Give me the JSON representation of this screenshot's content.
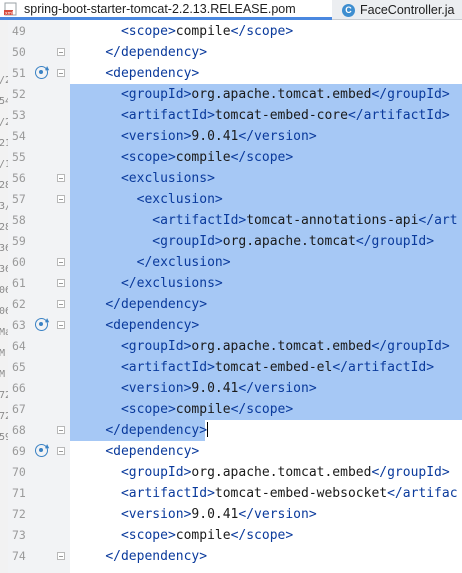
{
  "tabs": [
    {
      "label": "spring-boot-starter-tomcat-2.2.13.RELEASE.pom",
      "icon": "xml-file-icon",
      "active": true
    },
    {
      "label": "FaceController.ja",
      "icon": "java-class-icon",
      "active": false
    }
  ],
  "left_fragments": [
    "/2",
    "54",
    "/2",
    "21",
    "/1",
    "28",
    "3/",
    "28",
    "36",
    "36",
    "06",
    "06",
    "Ma",
    "M",
    "M",
    "72",
    "72",
    "59"
  ],
  "lines": [
    {
      "n": 49,
      "indent": 3,
      "parts": [
        [
          "tag",
          "<"
        ],
        [
          "tag",
          "scope"
        ],
        [
          "tag",
          ">"
        ],
        [
          "txt",
          "compile"
        ],
        [
          "tag",
          "</"
        ],
        [
          "tag",
          "scope"
        ],
        [
          "tag",
          ">"
        ]
      ]
    },
    {
      "n": 50,
      "indent": 2,
      "parts": [
        [
          "tag",
          "</"
        ],
        [
          "tag",
          "dependency"
        ],
        [
          "tag",
          ">"
        ]
      ]
    },
    {
      "n": 51,
      "indent": 2,
      "parts": [
        [
          "tag",
          "<"
        ],
        [
          "tag",
          "dependency"
        ],
        [
          "tag",
          ">"
        ]
      ]
    },
    {
      "n": 52,
      "indent": 3,
      "parts": [
        [
          "tag",
          "<"
        ],
        [
          "tag",
          "groupId"
        ],
        [
          "tag",
          ">"
        ],
        [
          "txt",
          "org.apache.tomcat.embed"
        ],
        [
          "tag",
          "</"
        ],
        [
          "tag",
          "groupId"
        ],
        [
          "tag",
          ">"
        ]
      ]
    },
    {
      "n": 53,
      "indent": 3,
      "parts": [
        [
          "tag",
          "<"
        ],
        [
          "tag",
          "artifactId"
        ],
        [
          "tag",
          ">"
        ],
        [
          "txt",
          "tomcat-embed-core"
        ],
        [
          "tag",
          "</"
        ],
        [
          "tag",
          "artifactId"
        ],
        [
          "tag",
          ">"
        ]
      ]
    },
    {
      "n": 54,
      "indent": 3,
      "parts": [
        [
          "tag",
          "<"
        ],
        [
          "tag",
          "version"
        ],
        [
          "tag",
          ">"
        ],
        [
          "txt",
          "9.0.41"
        ],
        [
          "tag",
          "</"
        ],
        [
          "tag",
          "version"
        ],
        [
          "tag",
          ">"
        ]
      ]
    },
    {
      "n": 55,
      "indent": 3,
      "parts": [
        [
          "tag",
          "<"
        ],
        [
          "tag",
          "scope"
        ],
        [
          "tag",
          ">"
        ],
        [
          "txt",
          "compile"
        ],
        [
          "tag",
          "</"
        ],
        [
          "tag",
          "scope"
        ],
        [
          "tag",
          ">"
        ]
      ]
    },
    {
      "n": 56,
      "indent": 3,
      "parts": [
        [
          "tag",
          "<"
        ],
        [
          "tag",
          "exclusions"
        ],
        [
          "tag",
          ">"
        ]
      ]
    },
    {
      "n": 57,
      "indent": 4,
      "parts": [
        [
          "tag",
          "<"
        ],
        [
          "tag",
          "exclusion"
        ],
        [
          "tag",
          ">"
        ]
      ]
    },
    {
      "n": 58,
      "indent": 5,
      "parts": [
        [
          "tag",
          "<"
        ],
        [
          "tag",
          "artifactId"
        ],
        [
          "tag",
          ">"
        ],
        [
          "txt",
          "tomcat-annotations-api"
        ],
        [
          "tag",
          "</"
        ],
        [
          "tag",
          "art"
        ]
      ]
    },
    {
      "n": 59,
      "indent": 5,
      "parts": [
        [
          "tag",
          "<"
        ],
        [
          "tag",
          "groupId"
        ],
        [
          "tag",
          ">"
        ],
        [
          "txt",
          "org.apache.tomcat"
        ],
        [
          "tag",
          "</"
        ],
        [
          "tag",
          "groupId"
        ],
        [
          "tag",
          ">"
        ]
      ]
    },
    {
      "n": 60,
      "indent": 4,
      "parts": [
        [
          "tag",
          "</"
        ],
        [
          "tag",
          "exclusion"
        ],
        [
          "tag",
          ">"
        ]
      ]
    },
    {
      "n": 61,
      "indent": 3,
      "parts": [
        [
          "tag",
          "</"
        ],
        [
          "tag",
          "exclusions"
        ],
        [
          "tag",
          ">"
        ]
      ]
    },
    {
      "n": 62,
      "indent": 2,
      "parts": [
        [
          "tag",
          "</"
        ],
        [
          "tag",
          "dependency"
        ],
        [
          "tag",
          ">"
        ]
      ]
    },
    {
      "n": 63,
      "indent": 2,
      "parts": [
        [
          "tag",
          "<"
        ],
        [
          "tag",
          "dependency"
        ],
        [
          "tag",
          ">"
        ]
      ]
    },
    {
      "n": 64,
      "indent": 3,
      "parts": [
        [
          "tag",
          "<"
        ],
        [
          "tag",
          "groupId"
        ],
        [
          "tag",
          ">"
        ],
        [
          "txt",
          "org.apache.tomcat.embed"
        ],
        [
          "tag",
          "</"
        ],
        [
          "tag",
          "groupId"
        ],
        [
          "tag",
          ">"
        ]
      ]
    },
    {
      "n": 65,
      "indent": 3,
      "parts": [
        [
          "tag",
          "<"
        ],
        [
          "tag",
          "artifactId"
        ],
        [
          "tag",
          ">"
        ],
        [
          "txt",
          "tomcat-embed-el"
        ],
        [
          "tag",
          "</"
        ],
        [
          "tag",
          "artifactId"
        ],
        [
          "tag",
          ">"
        ]
      ]
    },
    {
      "n": 66,
      "indent": 3,
      "parts": [
        [
          "tag",
          "<"
        ],
        [
          "tag",
          "version"
        ],
        [
          "tag",
          ">"
        ],
        [
          "txt",
          "9.0.41"
        ],
        [
          "tag",
          "</"
        ],
        [
          "tag",
          "version"
        ],
        [
          "tag",
          ">"
        ]
      ]
    },
    {
      "n": 67,
      "indent": 3,
      "parts": [
        [
          "tag",
          "<"
        ],
        [
          "tag",
          "scope"
        ],
        [
          "tag",
          ">"
        ],
        [
          "txt",
          "compile"
        ],
        [
          "tag",
          "</"
        ],
        [
          "tag",
          "scope"
        ],
        [
          "tag",
          ">"
        ]
      ]
    },
    {
      "n": 68,
      "indent": 2,
      "parts": [
        [
          "tag",
          "</"
        ],
        [
          "tag",
          "dependency"
        ],
        [
          "tag",
          ">"
        ]
      ]
    },
    {
      "n": 69,
      "indent": 2,
      "parts": [
        [
          "tag",
          "<"
        ],
        [
          "tag",
          "dependency"
        ],
        [
          "tag",
          ">"
        ]
      ]
    },
    {
      "n": 70,
      "indent": 3,
      "parts": [
        [
          "tag",
          "<"
        ],
        [
          "tag",
          "groupId"
        ],
        [
          "tag",
          ">"
        ],
        [
          "txt",
          "org.apache.tomcat.embed"
        ],
        [
          "tag",
          "</"
        ],
        [
          "tag",
          "groupId"
        ],
        [
          "tag",
          ">"
        ]
      ]
    },
    {
      "n": 71,
      "indent": 3,
      "parts": [
        [
          "tag",
          "<"
        ],
        [
          "tag",
          "artifactId"
        ],
        [
          "tag",
          ">"
        ],
        [
          "txt",
          "tomcat-embed-websocket"
        ],
        [
          "tag",
          "</"
        ],
        [
          "tag",
          "artifac"
        ]
      ]
    },
    {
      "n": 72,
      "indent": 3,
      "parts": [
        [
          "tag",
          "<"
        ],
        [
          "tag",
          "version"
        ],
        [
          "tag",
          ">"
        ],
        [
          "txt",
          "9.0.41"
        ],
        [
          "tag",
          "</"
        ],
        [
          "tag",
          "version"
        ],
        [
          "tag",
          ">"
        ]
      ]
    },
    {
      "n": 73,
      "indent": 3,
      "parts": [
        [
          "tag",
          "<"
        ],
        [
          "tag",
          "scope"
        ],
        [
          "tag",
          ">"
        ],
        [
          "txt",
          "compile"
        ],
        [
          "tag",
          "</"
        ],
        [
          "tag",
          "scope"
        ],
        [
          "tag",
          ">"
        ]
      ]
    },
    {
      "n": 74,
      "indent": 2,
      "parts": [
        [
          "tag",
          "</"
        ],
        [
          "tag",
          "dependency"
        ],
        [
          "tag",
          ">"
        ]
      ]
    }
  ],
  "selection": {
    "first_line": 52,
    "last_line": 68,
    "caret_line": 68
  },
  "gutter_icons": {
    "lines": [
      51,
      63,
      69
    ],
    "icon": "override-marker-icon"
  },
  "fold_markers": [
    50,
    51,
    56,
    57,
    60,
    61,
    62,
    63,
    68,
    69,
    74
  ],
  "colors": {
    "tag": "#0a3a9c",
    "text": "#1a1a1a",
    "selection": "#a6c8f5",
    "gutter": "#f2f3f5",
    "tab_active_border": "#4a88e0"
  }
}
